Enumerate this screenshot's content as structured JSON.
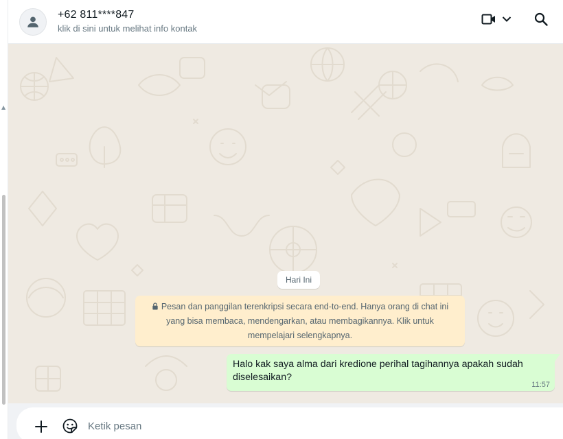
{
  "header": {
    "contact_name": "+62 811****847",
    "contact_subtitle": "klik di sini untuk melihat info kontak",
    "icons": [
      "person-avatar-icon",
      "video-call-icon",
      "chevron-down-icon",
      "search-icon"
    ]
  },
  "chat": {
    "date_chip": "Hari Ini",
    "encryption_notice": "Pesan dan panggilan terenkripsi secara end-to-end. Hanya orang di chat ini yang bisa membaca, mendengarkan, atau membagikannya. Klik untuk mempelajari selengkapnya.",
    "messages": [
      {
        "direction": "outgoing",
        "text": "Halo kak saya alma dari kredione perihal tagihannya apakah sudah diselesaikan?",
        "time": "11:57"
      }
    ]
  },
  "composer": {
    "placeholder": "Ketik pesan",
    "icons": [
      "plus-icon",
      "sticker-icon"
    ]
  },
  "colors": {
    "chat_background": "#efeae2",
    "outgoing_bubble": "#d9fdd3",
    "notice_background": "#ffeecd",
    "icon_color": "#54656f"
  }
}
